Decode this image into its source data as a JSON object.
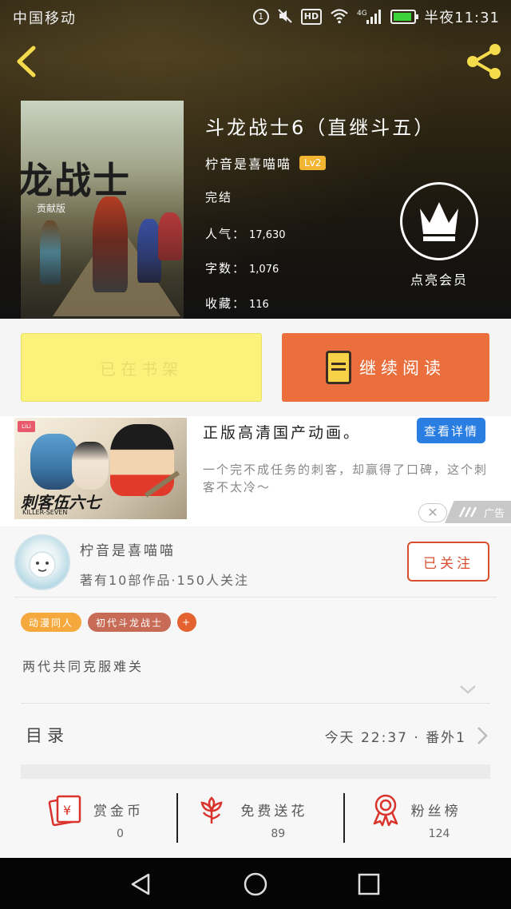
{
  "status_bar": {
    "carrier": "中国移动",
    "signal_label": "4G",
    "hd_label": "HD",
    "time": "半夜11:31"
  },
  "icons": {
    "back": "back-arrow-icon",
    "share": "share-icon",
    "vip": "crown-icon",
    "read": "book-icon",
    "coin": "red-envelope-icon",
    "flower": "flower-icon",
    "fans": "ribbon-medal-icon"
  },
  "book": {
    "title": "斗龙战士6（直继斗五）",
    "author": "柠音是喜喵喵",
    "level": "Lv2",
    "status": "完结",
    "popularity_label": "人气：",
    "popularity": "17,630",
    "words_label": "字数：",
    "words": "1,076",
    "favorites_label": "收藏：",
    "favorites": "116",
    "cover_title": "龙战士",
    "cover_sub": "贡献版"
  },
  "vip": {
    "label": "点亮会员"
  },
  "actions": {
    "shelf_label": "已在书架",
    "read_label": "继续阅读"
  },
  "ad": {
    "brand": "LiLi",
    "logo": "刺客伍六七",
    "logo_sub": "KILLER-SEVEN",
    "title": "正版高清国产动画。",
    "detail_button": "查看详情",
    "description": "一个完不成任务的刺客，却赢得了口碑，这个刺客不太冷～",
    "close": "✕",
    "tag": "广告"
  },
  "author": {
    "name": "柠音是喜喵喵",
    "stats": "著有10部作品·150人关注",
    "follow_label": "已关注"
  },
  "tags": [
    "动漫同人",
    "初代斗龙战士",
    "+"
  ],
  "description": "两代共同克服难关",
  "toc": {
    "label": "目录",
    "latest": "今天  22:37 · 番外1"
  },
  "rewards": [
    {
      "label": "赏金币",
      "count": "0"
    },
    {
      "label": "免费送花",
      "count": "89"
    },
    {
      "label": "粉丝榜",
      "count": "124"
    }
  ],
  "colors": {
    "accent_orange": "#ea6f3d",
    "shelf_yellow": "#fbf27b",
    "follow_red": "#d94f2e",
    "ad_blue": "#2a7de1",
    "reward_red": "#d9332b"
  }
}
